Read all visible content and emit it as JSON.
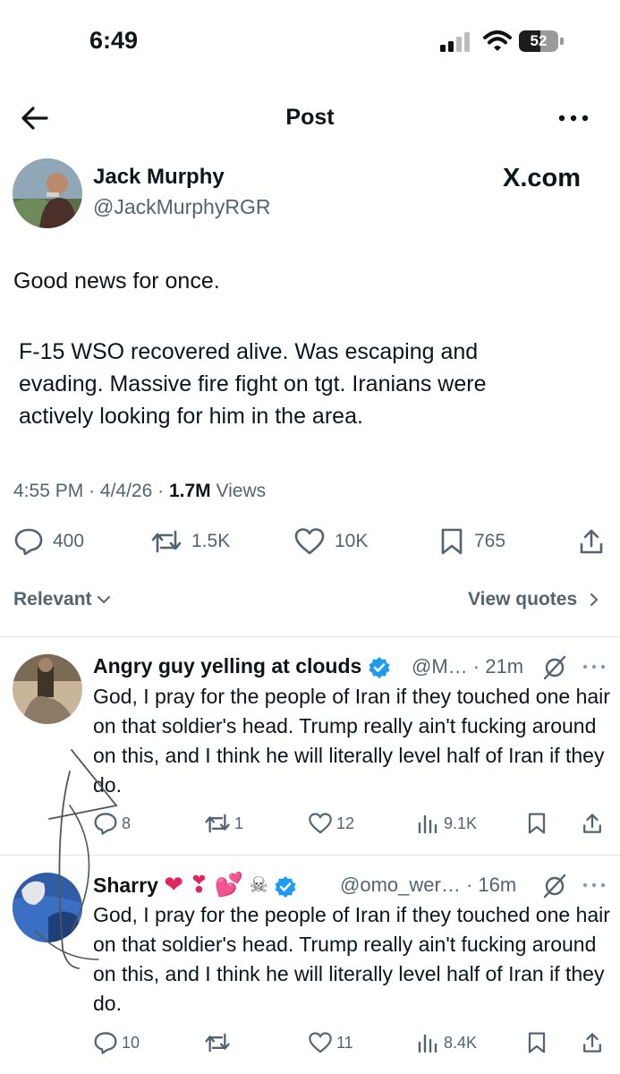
{
  "status_bar": {
    "time": "6:49",
    "battery": "52"
  },
  "nav": {
    "title": "Post"
  },
  "post": {
    "author_name": "Jack Murphy",
    "author_handle": "@JackMurphyRGR",
    "watermark": "X.com",
    "text_line1": "Good news for once.",
    "text_body": "F-15 WSO recovered alive. Was escaping and\nevading. Massive fire fight on tgt. Iranians were\nactively looking for him in the area.",
    "time": "4:55 PM",
    "date": "4/4/26",
    "views_count": "1.7M",
    "views_label": "Views",
    "replies": "400",
    "reposts": "1.5K",
    "likes": "10K",
    "bookmarks": "765"
  },
  "filter": {
    "sort_label": "Relevant",
    "view_quotes": "View quotes"
  },
  "replies": [
    {
      "name": "Angry guy yelling at clouds",
      "handle": "@M…",
      "time": "· 21m",
      "text": "God, I pray for the people of Iran if they touched one hair on that soldier's head. Trump really ain't fucking around on this, and I think he will literally level half of Iran if they do.",
      "replies": "8",
      "reposts": "1",
      "likes": "12",
      "views": "9.1K"
    },
    {
      "name": "Sharry",
      "handle": "@omo_wer…",
      "time": "· 16m",
      "text": "God, I pray for the people of Iran if they touched one hair on that soldier's head. Trump really ain't fucking around on this, and I think he will literally level half of Iran if they do.",
      "replies": "10",
      "reposts": "",
      "likes": "11",
      "views": "8.4K"
    }
  ],
  "colors": {
    "text": "#0f1419",
    "secondary": "#536471",
    "verified": "#1d9bf0",
    "divider": "#e1e6ea"
  }
}
